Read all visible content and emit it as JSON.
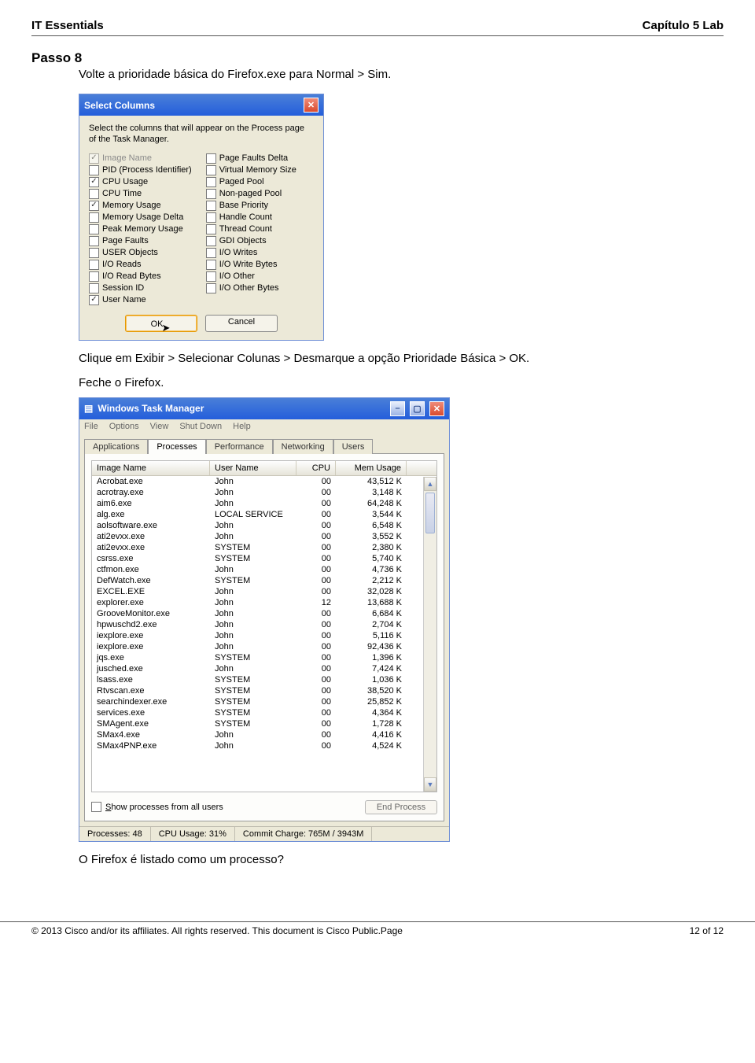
{
  "doc": {
    "header_left": "IT Essentials",
    "header_right": "Capítulo 5 Lab",
    "step_title": "Passo 8",
    "step_body": "Volte a prioridade básica do Firefox.exe para Normal > Sim.",
    "text_after_dialog": "Clique em Exibir > Selecionar Colunas > Desmarque a opção Prioridade Básica > OK.",
    "text_close_ff": "Feche o Firefox.",
    "question": "O Firefox é listado como um processo?",
    "footer_left": "© 2013 Cisco and/or its affiliates. All rights reserved. This document is Cisco Public.Page",
    "footer_right": "12 of 12"
  },
  "dialog": {
    "title": "Select Columns",
    "message": "Select the columns that will appear on the Process page of the Task Manager.",
    "left_options": [
      {
        "label": "Image Name",
        "checked": true,
        "disabled": true
      },
      {
        "label": "PID (Process Identifier)",
        "checked": false
      },
      {
        "label": "CPU Usage",
        "checked": true
      },
      {
        "label": "CPU Time",
        "checked": false
      },
      {
        "label": "Memory Usage",
        "checked": true
      },
      {
        "label": "Memory Usage Delta",
        "checked": false
      },
      {
        "label": "Peak Memory Usage",
        "checked": false
      },
      {
        "label": "Page Faults",
        "checked": false
      },
      {
        "label": "USER Objects",
        "checked": false
      },
      {
        "label": "I/O Reads",
        "checked": false
      },
      {
        "label": "I/O Read Bytes",
        "checked": false
      },
      {
        "label": "Session ID",
        "checked": false
      },
      {
        "label": "User Name",
        "checked": true
      }
    ],
    "right_options": [
      {
        "label": "Page Faults Delta",
        "checked": false
      },
      {
        "label": "Virtual Memory Size",
        "checked": false
      },
      {
        "label": "Paged Pool",
        "checked": false
      },
      {
        "label": "Non-paged Pool",
        "checked": false
      },
      {
        "label": "Base Priority",
        "checked": false
      },
      {
        "label": "Handle Count",
        "checked": false
      },
      {
        "label": "Thread Count",
        "checked": false
      },
      {
        "label": "GDI Objects",
        "checked": false
      },
      {
        "label": "I/O Writes",
        "checked": false
      },
      {
        "label": "I/O Write Bytes",
        "checked": false
      },
      {
        "label": "I/O Other",
        "checked": false
      },
      {
        "label": "I/O Other Bytes",
        "checked": false
      }
    ],
    "ok": "OK",
    "cancel": "Cancel"
  },
  "taskmgr": {
    "title": "Windows Task Manager",
    "menu": [
      "File",
      "Options",
      "View",
      "Shut Down",
      "Help"
    ],
    "tabs": [
      "Applications",
      "Processes",
      "Performance",
      "Networking",
      "Users"
    ],
    "active_tab": "Processes",
    "columns": [
      "Image Name",
      "User Name",
      "CPU",
      "Mem Usage"
    ],
    "rows": [
      {
        "img": "Acrobat.exe",
        "user": "John",
        "cpu": "00",
        "mem": "43,512 K"
      },
      {
        "img": "acrotray.exe",
        "user": "John",
        "cpu": "00",
        "mem": "3,148 K"
      },
      {
        "img": "aim6.exe",
        "user": "John",
        "cpu": "00",
        "mem": "64,248 K"
      },
      {
        "img": "alg.exe",
        "user": "LOCAL SERVICE",
        "cpu": "00",
        "mem": "3,544 K"
      },
      {
        "img": "aolsoftware.exe",
        "user": "John",
        "cpu": "00",
        "mem": "6,548 K"
      },
      {
        "img": "ati2evxx.exe",
        "user": "John",
        "cpu": "00",
        "mem": "3,552 K"
      },
      {
        "img": "ati2evxx.exe",
        "user": "SYSTEM",
        "cpu": "00",
        "mem": "2,380 K"
      },
      {
        "img": "csrss.exe",
        "user": "SYSTEM",
        "cpu": "00",
        "mem": "5,740 K"
      },
      {
        "img": "ctfmon.exe",
        "user": "John",
        "cpu": "00",
        "mem": "4,736 K"
      },
      {
        "img": "DefWatch.exe",
        "user": "SYSTEM",
        "cpu": "00",
        "mem": "2,212 K"
      },
      {
        "img": "EXCEL.EXE",
        "user": "John",
        "cpu": "00",
        "mem": "32,028 K"
      },
      {
        "img": "explorer.exe",
        "user": "John",
        "cpu": "12",
        "mem": "13,688 K"
      },
      {
        "img": "GrooveMonitor.exe",
        "user": "John",
        "cpu": "00",
        "mem": "6,684 K"
      },
      {
        "img": "hpwuschd2.exe",
        "user": "John",
        "cpu": "00",
        "mem": "2,704 K"
      },
      {
        "img": "iexplore.exe",
        "user": "John",
        "cpu": "00",
        "mem": "5,116 K"
      },
      {
        "img": "iexplore.exe",
        "user": "John",
        "cpu": "00",
        "mem": "92,436 K"
      },
      {
        "img": "jqs.exe",
        "user": "SYSTEM",
        "cpu": "00",
        "mem": "1,396 K"
      },
      {
        "img": "jusched.exe",
        "user": "John",
        "cpu": "00",
        "mem": "7,424 K"
      },
      {
        "img": "lsass.exe",
        "user": "SYSTEM",
        "cpu": "00",
        "mem": "1,036 K"
      },
      {
        "img": "Rtvscan.exe",
        "user": "SYSTEM",
        "cpu": "00",
        "mem": "38,520 K"
      },
      {
        "img": "searchindexer.exe",
        "user": "SYSTEM",
        "cpu": "00",
        "mem": "25,852 K"
      },
      {
        "img": "services.exe",
        "user": "SYSTEM",
        "cpu": "00",
        "mem": "4,364 K"
      },
      {
        "img": "SMAgent.exe",
        "user": "SYSTEM",
        "cpu": "00",
        "mem": "1,728 K"
      },
      {
        "img": "SMax4.exe",
        "user": "John",
        "cpu": "00",
        "mem": "4,416 K"
      },
      {
        "img": "SMax4PNP.exe",
        "user": "John",
        "cpu": "00",
        "mem": "4,524 K"
      }
    ],
    "show_all_label": "Show processes from all users",
    "end_process": "End Process",
    "status": {
      "procs": "Processes: 48",
      "cpu": "CPU Usage: 31%",
      "commit": "Commit Charge: 765M / 3943M"
    }
  }
}
